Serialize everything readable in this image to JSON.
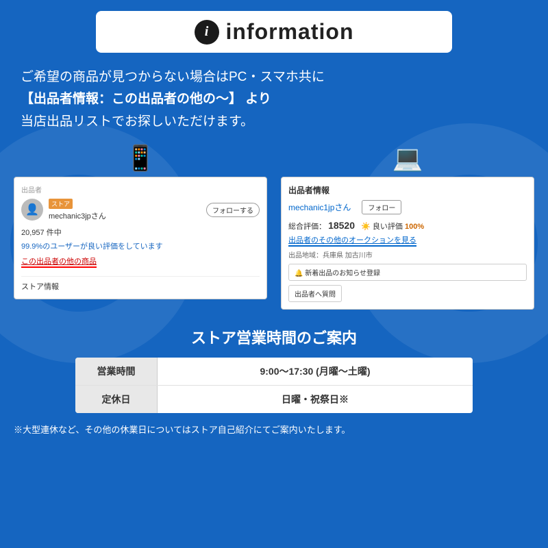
{
  "header": {
    "info_icon": "i",
    "title": "information"
  },
  "description": {
    "line1": "ご希望の商品が見つからない場合はPC・スマホ共に",
    "line2": "【出品者情報：この出品者の他の〜】 より",
    "line3": "当店出品リストでお探しいただけます。"
  },
  "mobile_screenshot": {
    "section_label": "出品者",
    "store_badge": "ストア",
    "seller_name": "mechanic3jpさん",
    "follow_label": "フォローする",
    "stats1": "20,957 件中",
    "stats2": "99.9%のユーザーが良い評価をしています",
    "link_text": "この出品者の他の商品",
    "divider": true,
    "store_info": "ストア情報"
  },
  "pc_screenshot": {
    "section_label": "出品者情報",
    "seller_name": "mechanic1jpさん",
    "follow_label": "フォロー",
    "rating_label": "総合評価：",
    "rating_num": "18520",
    "good_label": "良い評価",
    "good_pct": "100%",
    "auction_link": "出品者のその他のオークションを見る",
    "location_label": "出品地域：兵庫県 加古川市",
    "notify_btn": "🔔 新着出品のお知らせ登録",
    "question_btn": "出品者へ質問"
  },
  "store_hours": {
    "title": "ストア営業時間のご案内",
    "rows": [
      {
        "label": "営業時間",
        "value": "9:00〜17:30 (月曜〜土曜)"
      },
      {
        "label": "定休日",
        "value": "日曜・祝祭日※"
      }
    ],
    "note": "※大型連休など、その他の休業日についてはストア自己紹介にてご案内いたします。"
  }
}
